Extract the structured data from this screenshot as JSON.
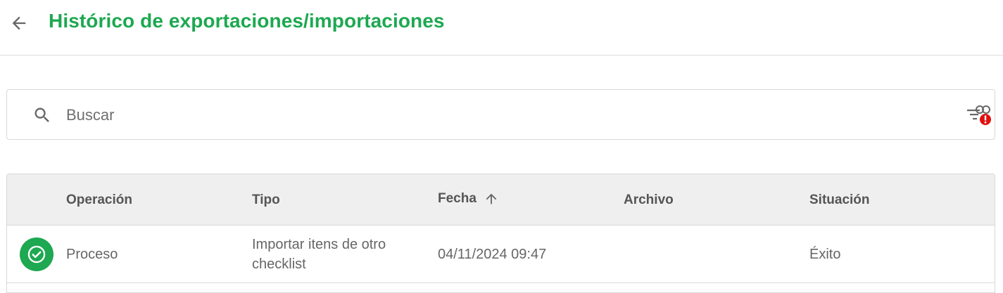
{
  "header": {
    "title": "Histórico de exportaciones/importaciones",
    "back_icon": "arrow-left-icon"
  },
  "search": {
    "placeholder": "Buscar",
    "value": "",
    "icon": "search-icon",
    "filter_icon": "filter-alert-icon"
  },
  "table": {
    "columns": [
      "Operación",
      "Tipo",
      "Fecha",
      "Archivo",
      "Situación"
    ],
    "sorted_by": "Fecha",
    "sort_direction": "ascending",
    "rows": [
      {
        "status_icon": "check-circle-icon",
        "operacion": "Proceso",
        "tipo": "Importar itens de otro checklist",
        "fecha": "04/11/2024 09:47",
        "archivo": "",
        "situacion": "Éxito"
      }
    ]
  },
  "colors": {
    "accent": "#1da851",
    "alert": "#e01010"
  }
}
